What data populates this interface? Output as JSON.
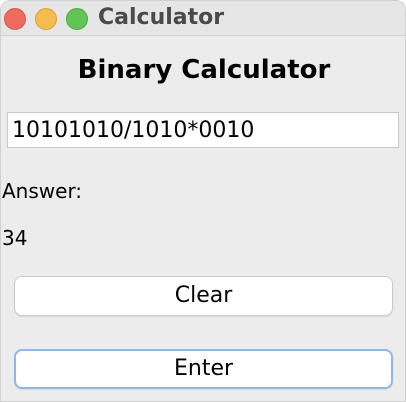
{
  "window": {
    "title": "Calculator"
  },
  "app": {
    "heading": "Binary Calculator"
  },
  "input": {
    "value": "10101010/1010*0010"
  },
  "answer": {
    "label": "Answer:",
    "value": "34"
  },
  "buttons": {
    "clear_label": "Clear",
    "enter_label": "Enter"
  },
  "colors": {
    "close": "#ee6a5f",
    "minimize": "#f5bd4f",
    "zoom": "#61c454",
    "focus_ring": "#8fb7ec"
  }
}
